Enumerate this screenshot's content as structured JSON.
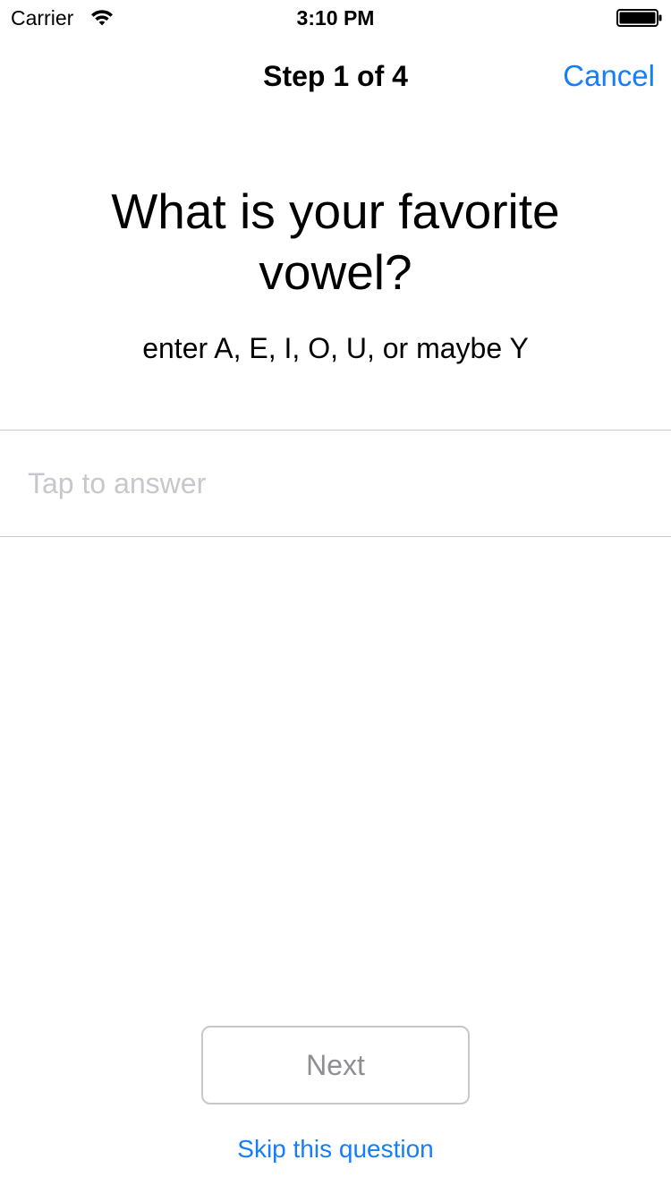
{
  "status_bar": {
    "carrier": "Carrier",
    "time": "3:10 PM",
    "wifi_icon": "wifi-icon",
    "battery_icon": "battery-full-icon"
  },
  "nav": {
    "title": "Step 1 of 4",
    "cancel_label": "Cancel"
  },
  "question": {
    "title": "What is your favorite vowel?",
    "detail": "enter A, E, I, O, U, or maybe Y"
  },
  "answer": {
    "value": "",
    "placeholder": "Tap to answer"
  },
  "footer": {
    "next_label": "Next",
    "next_enabled": false,
    "skip_label": "Skip this question"
  },
  "colors": {
    "accent": "#147efb",
    "divider": "#c8c7cc",
    "placeholder": "#c7c7cd",
    "disabled_text": "#8e8e93",
    "disabled_border": "#c7c7cc"
  }
}
